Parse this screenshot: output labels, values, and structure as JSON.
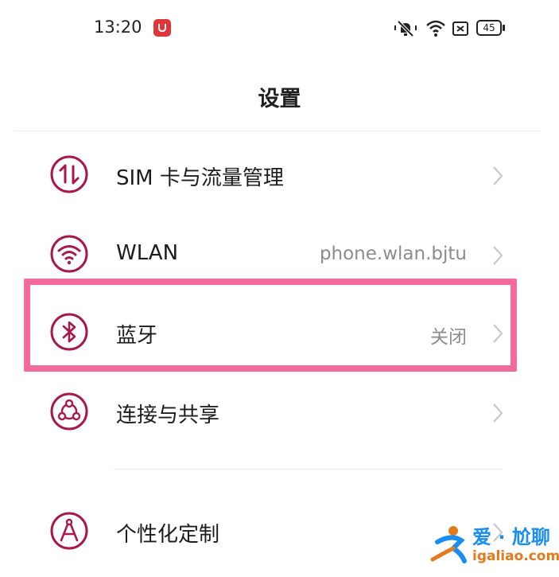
{
  "status_bar": {
    "time": "13:20",
    "battery": "45",
    "app_icon": "red-app-icon",
    "icons": [
      "mute-bell-icon",
      "wifi-icon",
      "sim-closed-icon",
      "battery-icon"
    ]
  },
  "header": {
    "title": "设置"
  },
  "settings": [
    {
      "id": "sim",
      "label": "SIM 卡与流量管理",
      "value": "",
      "icon": "data-transfer-icon"
    },
    {
      "id": "wlan",
      "label": "WLAN",
      "value": "phone.wlan.bjtu",
      "icon": "wifi-icon"
    },
    {
      "id": "bluetooth",
      "label": "蓝牙",
      "value": "关闭",
      "icon": "bluetooth-icon"
    },
    {
      "id": "share",
      "label": "连接与共享",
      "value": "",
      "icon": "share-nodes-icon"
    },
    {
      "id": "personalize",
      "label": "个性化定制",
      "value": "",
      "icon": "compass-icon"
    }
  ],
  "colors": {
    "icon_accent": "#a8184a",
    "highlight": "#f36b9c",
    "value_text": "#8c8c8c"
  },
  "watermark": {
    "title": "爱 · 尬聊",
    "url": "igaliao.com"
  }
}
